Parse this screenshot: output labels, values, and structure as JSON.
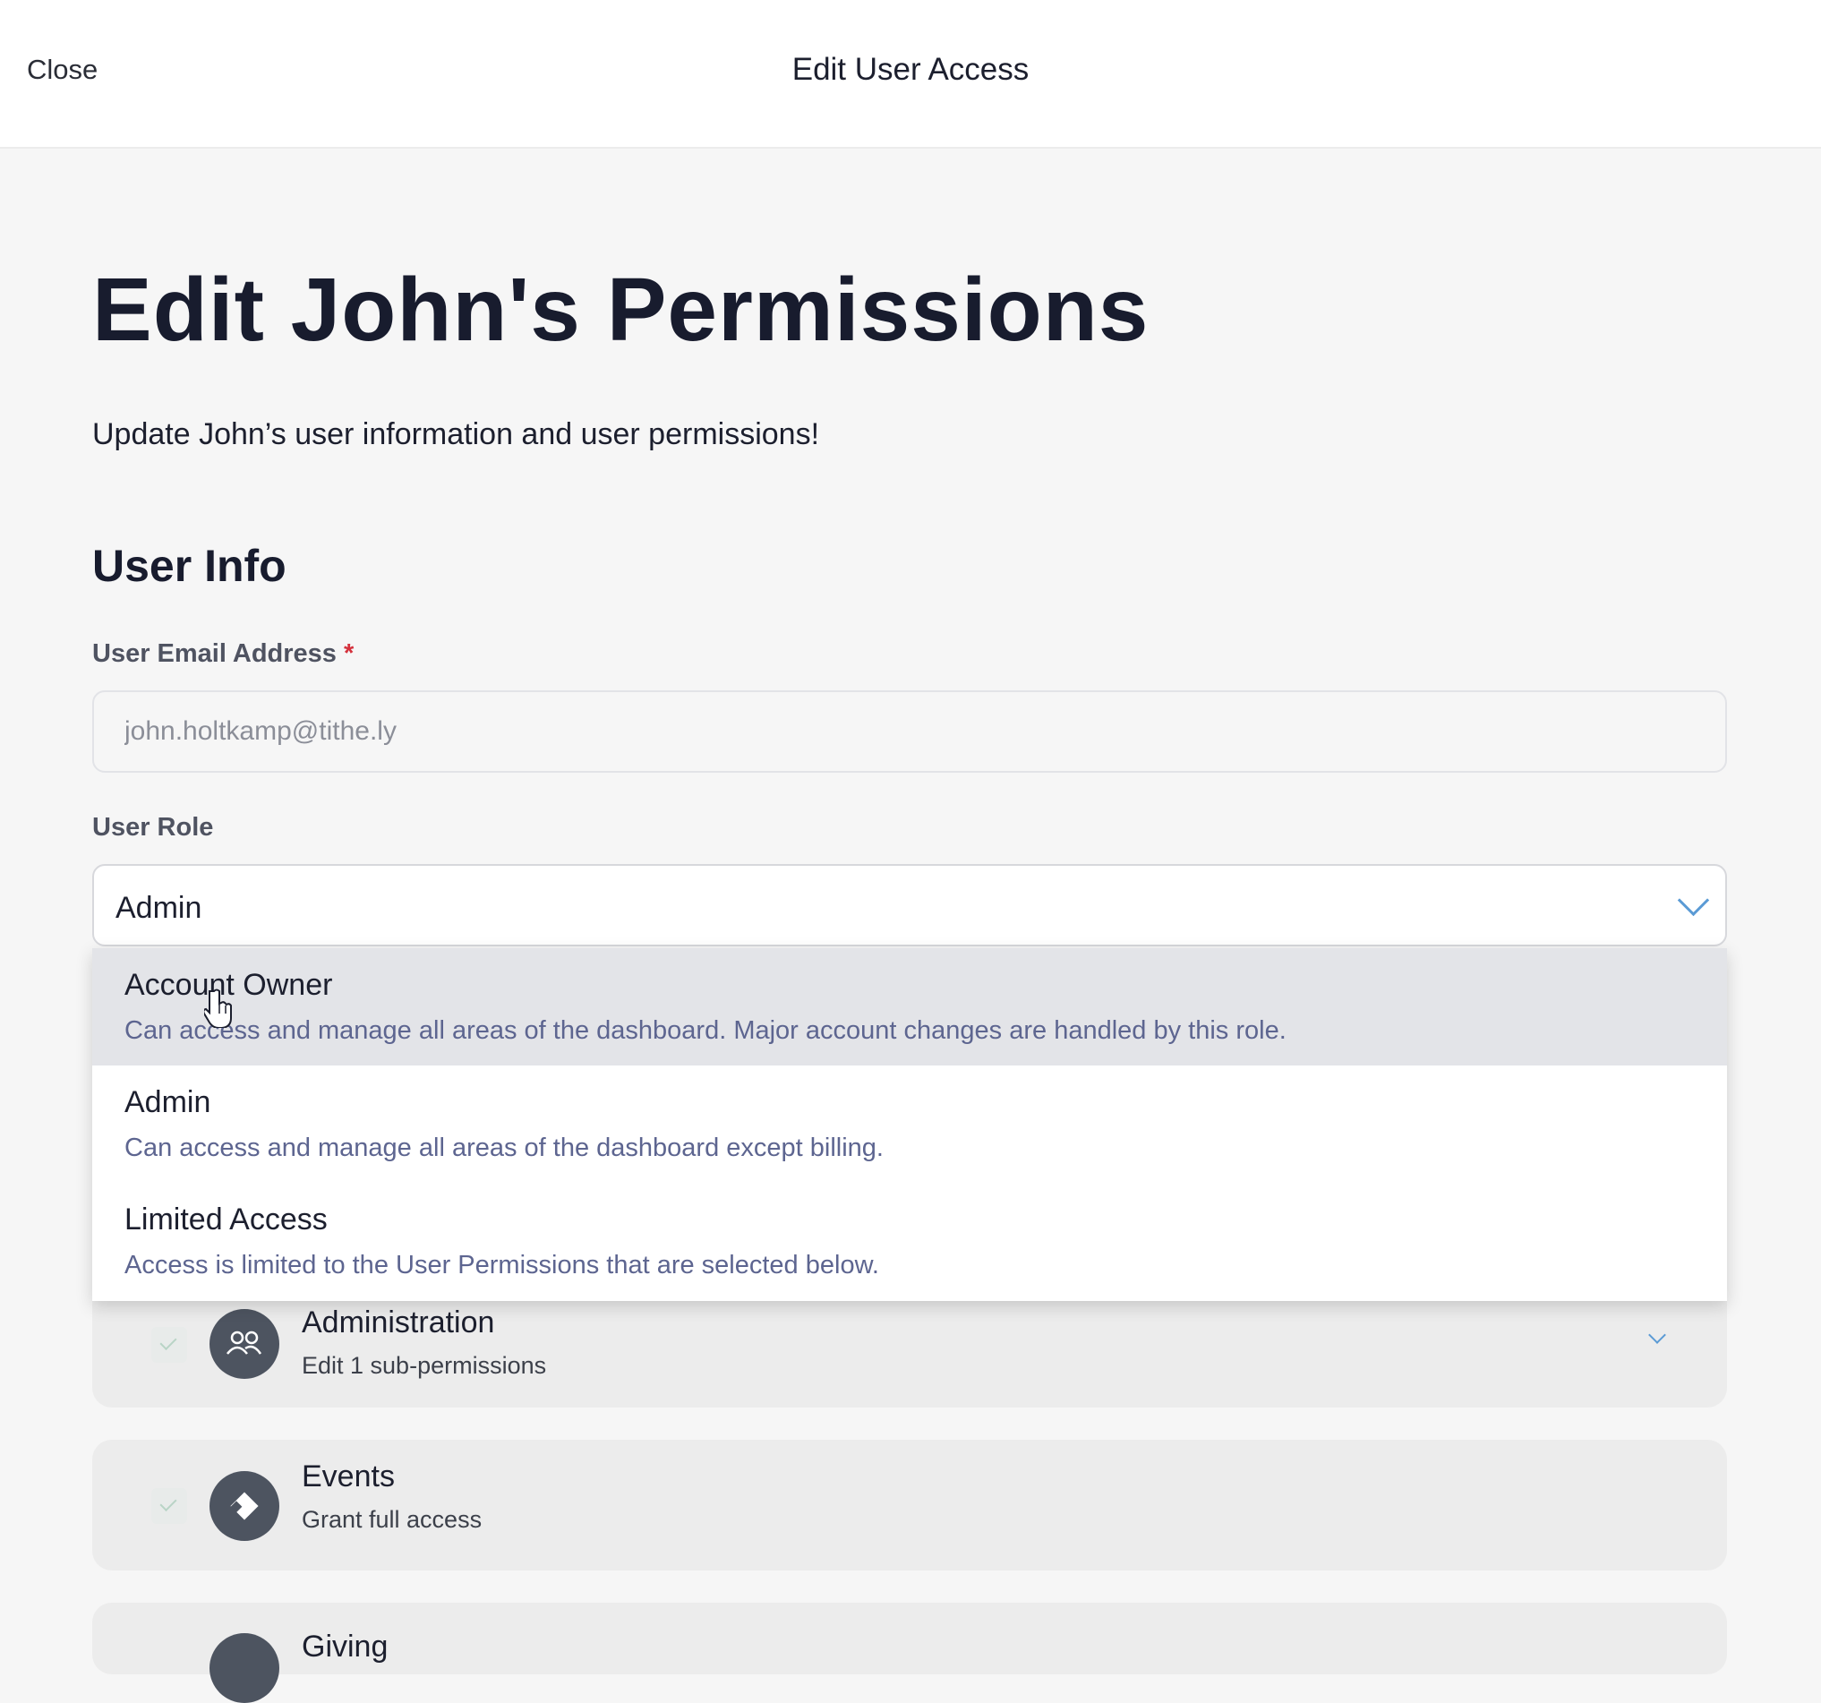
{
  "topbar": {
    "close_label": "Close",
    "title": "Edit User Access"
  },
  "page": {
    "title": "Edit John's Permissions",
    "subtitle": "Update John’s user information and user permissions!"
  },
  "user_info": {
    "section_title": "User Info",
    "email": {
      "label": "User Email Address",
      "required_mark": "*",
      "value": "john.holtkamp@tithe.ly"
    },
    "role": {
      "label": "User Role",
      "selected": "Admin",
      "options": [
        {
          "title": "Account Owner",
          "description": "Can access and manage all areas of the dashboard. Major account changes are handled by this role."
        },
        {
          "title": "Admin",
          "description": "Can access and manage all areas of the dashboard except billing."
        },
        {
          "title": "Limited Access",
          "description": "Access is limited to the User Permissions that are selected below."
        }
      ]
    }
  },
  "permissions": [
    {
      "title": "Administration",
      "subtitle": "Edit 1 sub-permissions",
      "icon": "users-icon"
    },
    {
      "title": "Events",
      "subtitle": "Grant full access",
      "icon": "ticket-icon"
    },
    {
      "title": "Giving",
      "subtitle": "",
      "icon": "giving-icon"
    }
  ],
  "colors": {
    "accent_chevron": "#5b9bd5",
    "option_description": "#5d6590",
    "required": "#d4313c",
    "perm_icon_bg": "#4d5460"
  }
}
